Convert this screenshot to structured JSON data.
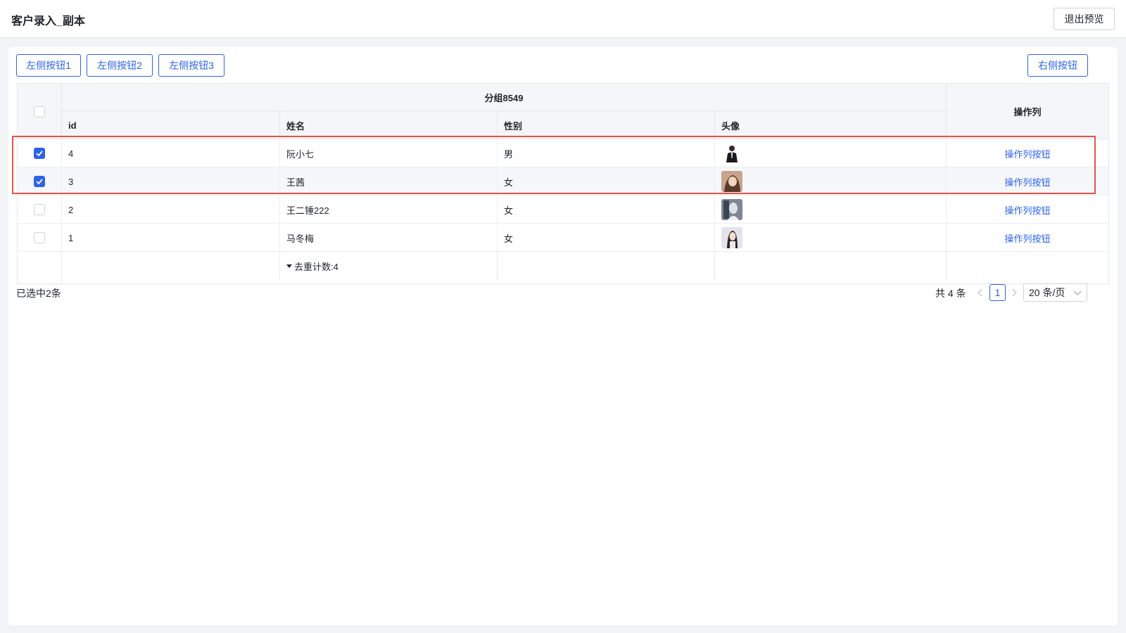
{
  "header": {
    "title": "客户录入_副本",
    "exit_label": "退出预览"
  },
  "toolbar": {
    "left_buttons": [
      "左侧按钮1",
      "左侧按钮2",
      "左侧按钮3"
    ],
    "right_button": "右侧按钮"
  },
  "table": {
    "group_title": "分组8549",
    "columns": [
      "id",
      "姓名",
      "性别",
      "头像"
    ],
    "op_column": "操作列",
    "rows": [
      {
        "id": "4",
        "name": "阮小七",
        "gender": "男",
        "avatar": "avatar-man-suit",
        "checked": true,
        "op": "操作列按钮"
      },
      {
        "id": "3",
        "name": "王茜",
        "gender": "女",
        "avatar": "avatar-woman-1",
        "checked": true,
        "op": "操作列按钮"
      },
      {
        "id": "2",
        "name": "王二锤222",
        "gender": "女",
        "avatar": "avatar-woman-2",
        "checked": false,
        "op": "操作列按钮"
      },
      {
        "id": "1",
        "name": "马冬梅",
        "gender": "女",
        "avatar": "avatar-woman-3",
        "checked": false,
        "op": "操作列按钮"
      }
    ],
    "summary": "去重计数:4"
  },
  "footer": {
    "selected_text": "已选中2条",
    "total_text": "共 4 条",
    "current_page": "1",
    "page_size": "20 条/页"
  },
  "colors": {
    "accent": "#2e63e8",
    "highlight": "#e5534b"
  }
}
